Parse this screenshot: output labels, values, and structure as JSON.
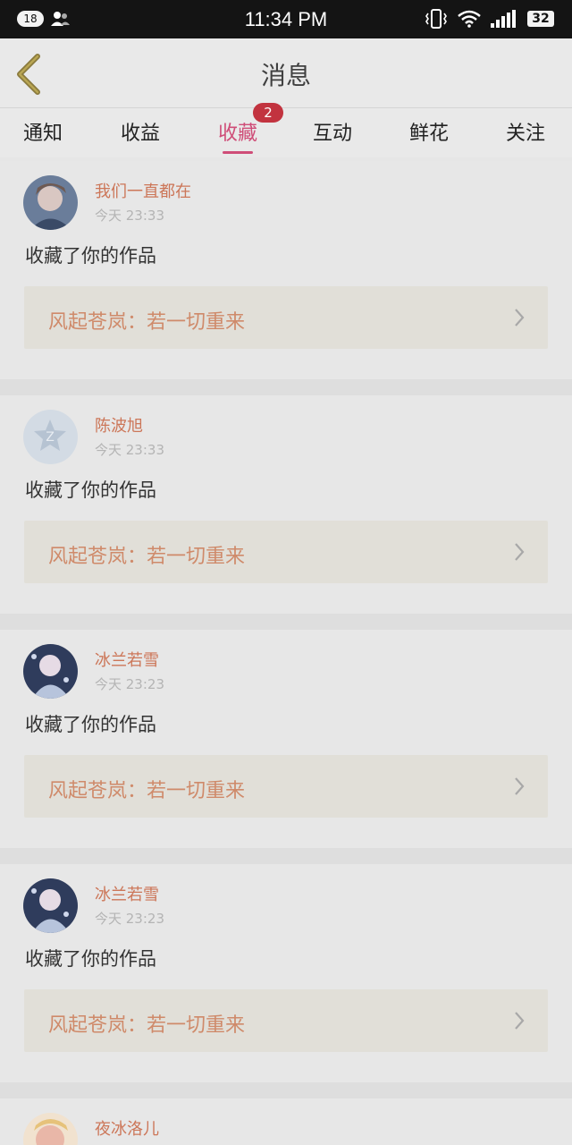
{
  "status_bar": {
    "notification_count": "18",
    "time": "11:34 PM",
    "battery": "32"
  },
  "header": {
    "title": "消息"
  },
  "tabs": [
    {
      "label": "通知"
    },
    {
      "label": "收益"
    },
    {
      "label": "收藏",
      "active": true,
      "badge": "2"
    },
    {
      "label": "互动"
    },
    {
      "label": "鲜花"
    },
    {
      "label": "关注"
    }
  ],
  "messages": [
    {
      "user": "我们一直都在",
      "time": "今天 23:33",
      "action": "收藏了你的作品",
      "work": "风起苍岚：若一切重来"
    },
    {
      "user": "陈波旭",
      "time": "今天 23:33",
      "action": "收藏了你的作品",
      "work": "风起苍岚：若一切重来"
    },
    {
      "user": "冰兰若雪",
      "time": "今天 23:23",
      "action": "收藏了你的作品",
      "work": "风起苍岚：若一切重来"
    },
    {
      "user": "冰兰若雪",
      "time": "今天 23:23",
      "action": "收藏了你的作品",
      "work": "风起苍岚：若一切重来"
    },
    {
      "user": "夜冰洛儿"
    }
  ],
  "colors": {
    "accent": "#cf4d78",
    "badge": "#c2333f",
    "username": "#cc7658",
    "work_title": "#cf8a6a"
  }
}
